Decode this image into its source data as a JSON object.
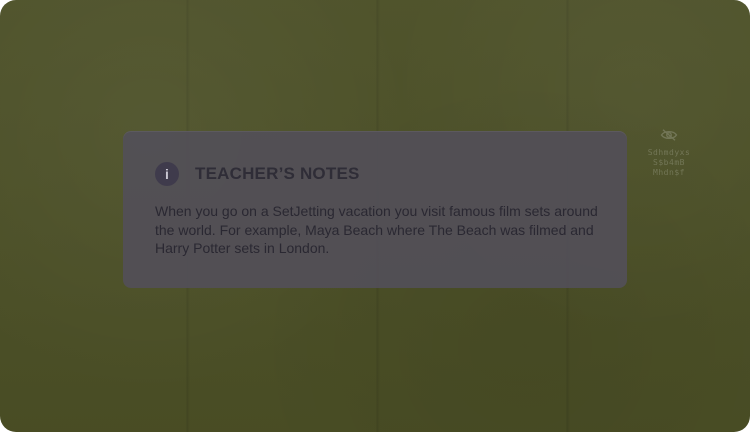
{
  "notes": {
    "title": "TEACHER’S NOTES",
    "body": "When you go on a SetJetting vacation you visit famous film sets around the world. For example, Maya Beach where The Beach was filmed and Harry Potter sets in London.",
    "icon": "info-icon"
  },
  "ghost": {
    "icon": "eye-off-icon",
    "lines": [
      "Sdhmdyxs",
      "S$b4mB",
      "Mhdn$f"
    ]
  }
}
